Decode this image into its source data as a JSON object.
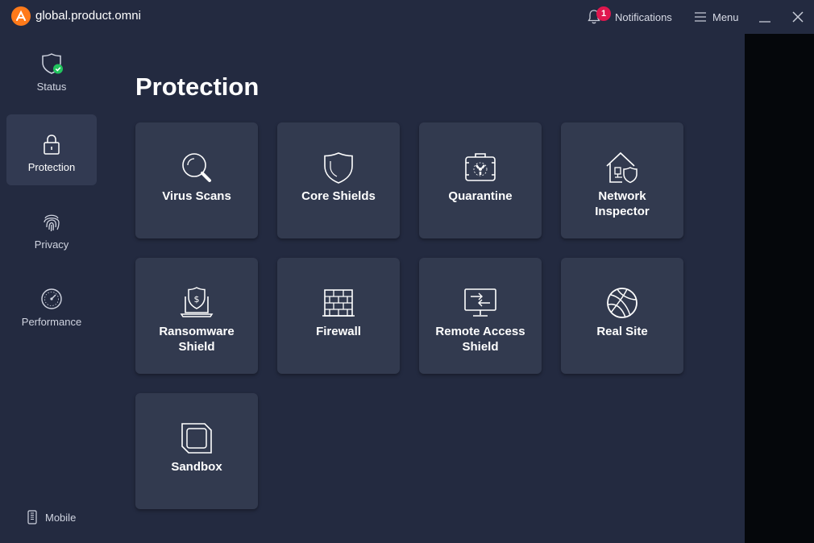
{
  "app": {
    "title": "global.product.omni"
  },
  "header": {
    "notifications_label": "Notifications",
    "notifications_count": "1",
    "menu_label": "Menu"
  },
  "sidebar": {
    "items": [
      {
        "label": "Status",
        "icon": "shield-check-icon"
      },
      {
        "label": "Protection",
        "icon": "lock-icon",
        "active": true
      },
      {
        "label": "Privacy",
        "icon": "fingerprint-icon"
      },
      {
        "label": "Performance",
        "icon": "gauge-icon"
      }
    ],
    "mobile_label": "Mobile"
  },
  "main": {
    "title": "Protection",
    "tiles": [
      {
        "label": "Virus Scans",
        "icon": "magnifier-icon"
      },
      {
        "label": "Core Shields",
        "icon": "shield-icon"
      },
      {
        "label": "Quarantine",
        "icon": "quarantine-box-icon"
      },
      {
        "label": "Network\nInspector",
        "icon": "house-shield-icon"
      },
      {
        "label": "Ransomware\nShield",
        "icon": "laptop-dollar-shield-icon"
      },
      {
        "label": "Firewall",
        "icon": "brick-wall-icon"
      },
      {
        "label": "Remote Access\nShield",
        "icon": "monitor-arrows-icon"
      },
      {
        "label": "Real Site",
        "icon": "globe-icon"
      },
      {
        "label": "Sandbox",
        "icon": "sandbox-square-icon"
      }
    ]
  },
  "colors": {
    "background": "#232a40",
    "tile": "#323a4f",
    "sidebar_active": "#323a52",
    "accent_orange": "#ff7a1a",
    "badge_red": "#e0174e",
    "status_green": "#22c55e",
    "right_strip": "#05070b"
  }
}
